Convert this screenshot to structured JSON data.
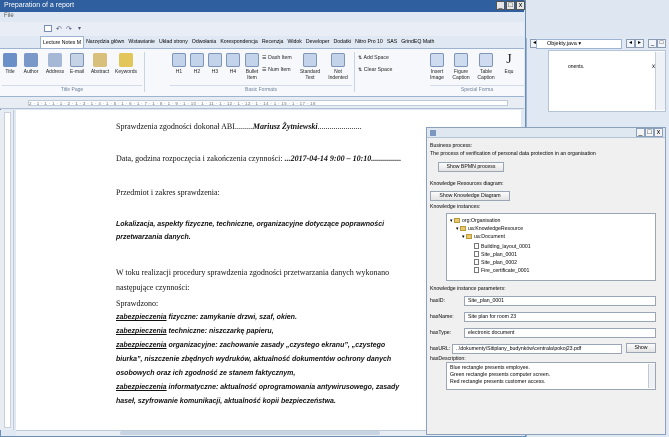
{
  "window": {
    "title": "Preparation of a report",
    "file_menu": "File"
  },
  "ribbon_tabs": [
    "Lecture Notes M",
    "Narzędzia główn",
    "Wstawianie",
    "Układ strony",
    "Odwołania",
    "Korespondencja",
    "Recenzja",
    "Widok",
    "Developer",
    "Dodatki",
    "Nitro Pro 10",
    "SAS",
    "GrindEQ Math"
  ],
  "ribbon": {
    "title_page": [
      "Title",
      "Author",
      "Address",
      "E-mail",
      "Abstract",
      "Keywords"
    ],
    "basic_formats": [
      "H1",
      "H2",
      "H3",
      "H4",
      "Bullet Item",
      "Dash Item",
      "Num Item",
      "Standard Text",
      "Not Indented"
    ],
    "special": [
      "Add Space",
      "Clear Space",
      "Insert Image",
      "Figure Caption",
      "Table Caption",
      "Equ"
    ],
    "groups": {
      "title_page": "Title Page",
      "basic_formats": "Basic Formats",
      "special_formats": "Special Forma"
    }
  },
  "ruler_text": "2 · 1 · 1 · 1 · 1 · 2 · 1 · 3 · 1 · 4 · 1 · 5 · 1 · 6 · 1 · 7 · 1 · 8 · 1 · 9 · 1 · 10 · 1 · 11 · 1 · 12 · 1 · 13 · 1 · 14 · 1 · 15 · 1 · 17 · 18",
  "document": {
    "line1_prefix": "Sprawdzenia zgodności dokonał ABI",
    "line1_dots": ".........",
    "line1_name": "Mariusz Żytniewski",
    "line1_suffix": "......................",
    "line2_prefix": "Data, godzina rozpoczęcia i zakończenia czynności: ",
    "line2_value": "...2017-04-14  9:00 – 10:10...............",
    "line3": "Przedmiot i zakres sprawdzenia:",
    "bold1": "Lokalizacja,   aspekty   fizyczne,   techniczne,   organizacyjne  dotyczące  poprawności",
    "bold2": "przetwarzania danych.",
    "para1": "W   toku   realizacji   procedury   sprawdzenia   zgodności   przetwarzania   danych   wykonano",
    "para2": "następujące czynności:",
    "sprawdzono": "Sprawdzono:",
    "z1_u": "zabezpieczenia",
    "z1": " fizyczne: zamykanie drzwi, szaf, okien.",
    "z2_u": "zabezpieczenia",
    "z2": " techniczne: niszczarkę papieru,",
    "z3_u": "zabezpieczenia",
    "z3": "  organizacyjne:  zachowanie  zasady  „czystego  ekranu”,  „czystego",
    "z3b": "biurka”,  niszczenie  zbędnych  wydruków,  aktualność  dokumentów  ochrony  danych",
    "z3c": "osobowych oraz ich zgodność ze stanem faktycznym,",
    "z4_u": "zabezpieczenia",
    "z4": "  informatyczne:  aktualność  oprogramowania  antywirusowego,  zasady",
    "z4b": "haseł, szyfrowanie komunikacji, aktualność kopii bezpieczeństwa."
  },
  "side_window": {
    "tab": "Objekty.java",
    "text": "onents.",
    "close": "x"
  },
  "dialog": {
    "bp_label": "Business process:",
    "bp_text": "The process of verification of personal data protection in an organisation",
    "bp_button": "Show BPMN process",
    "kr_label": "Knowledge Resources diagram:",
    "kr_button": "Show Knowledge Diagram",
    "ki_label": "Knowledge instances:",
    "tree": [
      "org:Organisation",
      "ua:KnowledgeResource",
      "ua:Document",
      "Building_layout_0001",
      "Site_plan_0001",
      "Site_plan_0002",
      "Fire_certificate_0001"
    ],
    "params_label": "Knowledge instance parameters:",
    "hasID_label": "hasID:",
    "hasID": "Site_plan_0001",
    "hasName_label": "hasName:",
    "hasName": "Site plan for room 23",
    "hasType_label": "hasType:",
    "hasType": "electronic document",
    "hasURL_label": "hasURL:",
    "hasURL": "..\\dokumenty\\Sitiplany_budynków\\centrala\\pokoj23.pdf",
    "show_button": "Show",
    "desc_label": "hasDescription:",
    "desc": [
      "Blue rectangle presents employee.",
      "Green rectangle presents computer screen.",
      "Red rectangle presents customer access."
    ]
  }
}
